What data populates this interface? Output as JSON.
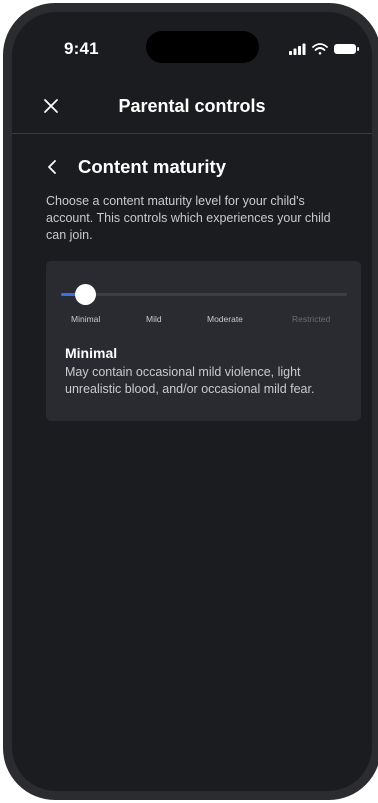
{
  "status_bar": {
    "time": "9:41",
    "icons": [
      "signal-icon",
      "wifi-icon",
      "battery-icon"
    ]
  },
  "header": {
    "title": "Parental controls",
    "close_icon": "close-icon"
  },
  "section": {
    "back_icon": "chevron-left-icon",
    "title": "Content maturity",
    "description": "Choose a content maturity level for your child's account. This controls which experiences your child can join."
  },
  "slider": {
    "levels": [
      "Minimal",
      "Mild",
      "Moderate",
      "Restricted"
    ],
    "selected_index": 0,
    "selected_level": "Minimal",
    "selected_description": "May contain occasional mild violence, light unrealistic blood, and/or occasional mild fear."
  },
  "colors": {
    "background": "#1b1c20",
    "card": "#2a2b30",
    "accent": "#3a6fe3",
    "text": "#ffffff",
    "muted_text": "#c9cacd",
    "disabled_text": "#6b6c72"
  }
}
